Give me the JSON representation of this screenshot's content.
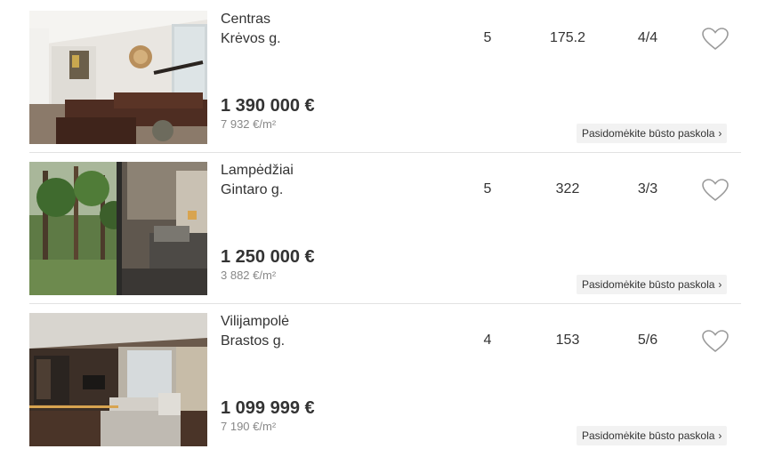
{
  "listings": [
    {
      "district": "Centras",
      "street": "Krėvos g.",
      "rooms": "5",
      "area": "175.2",
      "floor": "4/4",
      "price": "1 390 000 €",
      "price_per_m2": "7 932 €/m²",
      "loan_label": "Pasidomėkite būsto paskola",
      "loan_chevron": "›",
      "favorite_icon": "heart-outline-icon"
    },
    {
      "district": "Lampėdžiai",
      "street": "Gintaro g.",
      "rooms": "5",
      "area": "322",
      "floor": "3/3",
      "price": "1 250 000 €",
      "price_per_m2": "3 882 €/m²",
      "loan_label": "Pasidomėkite būsto paskola",
      "loan_chevron": "›",
      "favorite_icon": "heart-outline-icon"
    },
    {
      "district": "Vilijampolė",
      "street": "Brastos g.",
      "rooms": "4",
      "area": "153",
      "floor": "5/6",
      "price": "1 099 999 €",
      "price_per_m2": "7 190 €/m²",
      "loan_label": "Pasidomėkite būsto paskola",
      "loan_chevron": "›",
      "favorite_icon": "heart-outline-icon"
    }
  ],
  "colors": {
    "text": "#333333",
    "muted": "#888888",
    "divider": "#e2e2e2",
    "loan_bg": "#f2f2f2",
    "heart": "#9a9a9a"
  }
}
